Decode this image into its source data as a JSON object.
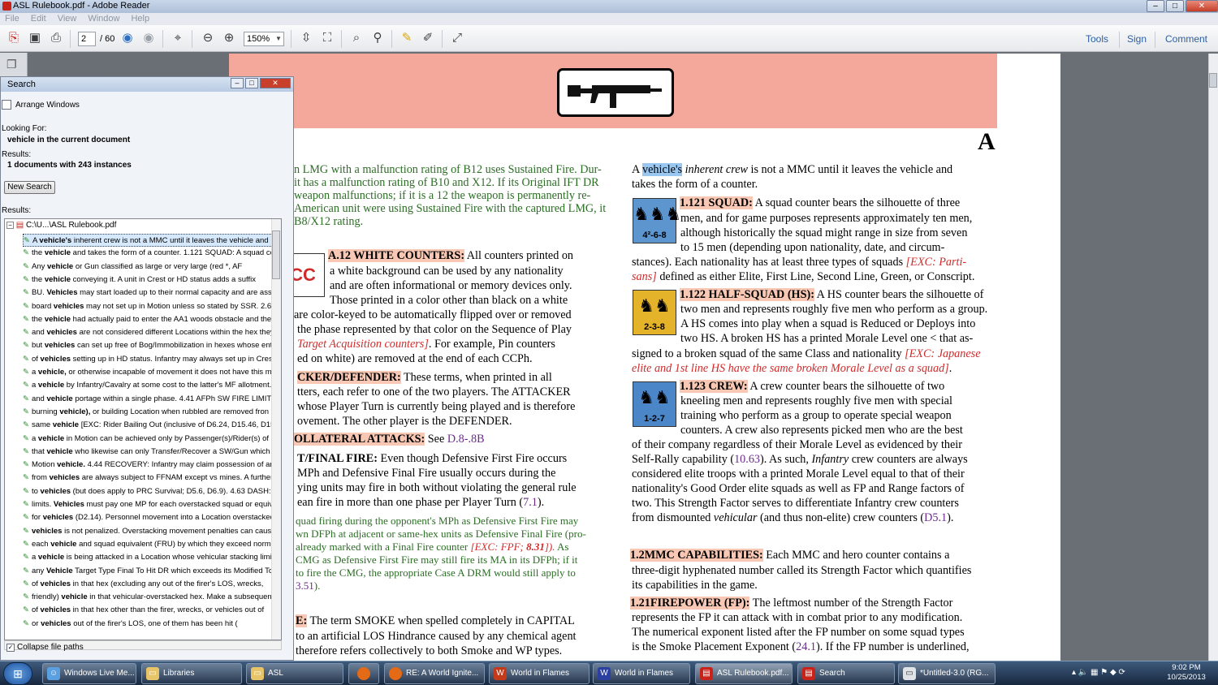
{
  "window": {
    "title": "ASL Rulebook.pdf - Adobe Reader",
    "minimize": "–",
    "maximize": "□",
    "close": "✕"
  },
  "menu": [
    "File",
    "Edit",
    "View",
    "Window",
    "Help"
  ],
  "toolbar": {
    "page_current": "2",
    "page_total": "/ 60",
    "zoom": "150%",
    "tools": "Tools",
    "sign": "Sign",
    "comment": "Comment"
  },
  "search": {
    "title": "Search",
    "arrange_windows": "Arrange Windows",
    "looking_for_label": "Looking For:",
    "looking_for_value": "vehicle in the current document",
    "results_label": "Results:",
    "results_value": "1 documents with 243 instances",
    "new_search": "New Search",
    "results_label2": "Results:",
    "tree_root": "C:\\U...\\ASL Rulebook.pdf",
    "collapse_label": "Collapse file paths",
    "results": [
      {
        "pre": "A ",
        "kw": "vehicle's",
        "post": " inherent crew is not a MMC until it leaves the vehicle and"
      },
      {
        "pre": "the ",
        "kw": "vehicle",
        "post": " and takes the form of a counter. 1.121 SQUAD: A squad co"
      },
      {
        "pre": "Any ",
        "kw": "vehicle",
        "post": " or Gun classified as large or very large (red *, AF"
      },
      {
        "pre": "the ",
        "kw": "vehicle",
        "post": " conveying it. A unit in Crest or HD status adds a suffix"
      },
      {
        "pre": "BU. ",
        "kw": "Vehicles",
        "post": " may start loaded up to their normal capacity and are assu"
      },
      {
        "pre": "board ",
        "kw": "vehicles",
        "post": " may not set up in Motion unless so stated by SSR. 2.6"
      },
      {
        "pre": "the ",
        "kw": "vehicle",
        "post": " had actually paid to enter the AA1 woods obstacle and the"
      },
      {
        "pre": "and ",
        "kw": "vehicles",
        "post": " are not considered different Locations within the hex they"
      },
      {
        "pre": "but ",
        "kw": "vehicles",
        "post": " can set up free of Bog/Immobilization in hexes whose ent"
      },
      {
        "pre": "of ",
        "kw": "vehicles",
        "post": " setting up in HD status. Infantry may always set up in Crest"
      },
      {
        "pre": "a ",
        "kw": "vehicle,",
        "post": " or otherwise incapable of movement it does not have this m"
      },
      {
        "pre": "a ",
        "kw": "vehicle",
        "post": " by Infantry/Cavalry at some cost to the latter's MF allotment."
      },
      {
        "pre": "and ",
        "kw": "vehicle",
        "post": " portage within a single phase. 4.41 AFPh SW FIRE LIMITS: I"
      },
      {
        "pre": "burning ",
        "kw": "vehicle),",
        "post": " or building Location when rubbled are removed fron"
      },
      {
        "pre": "same ",
        "kw": "vehicle",
        "post": " [EXC: Rider Bailing Out (inclusive of D6.24, D15.46, D15.5"
      },
      {
        "pre": "a ",
        "kw": "vehicle",
        "post": " in Motion can be achieved only by Passenger(s)/Rider(s) of"
      },
      {
        "pre": "that ",
        "kw": "vehicle",
        "post": " who likewise can only Transfer/Recover a SW/Gun which i"
      },
      {
        "pre": "Motion ",
        "kw": "vehicle.",
        "post": " 4.44 RECOVERY: Infantry may claim possession of an u"
      },
      {
        "pre": "from ",
        "kw": "vehicles",
        "post": " are always subject to FFNAM except vs mines. A further"
      },
      {
        "pre": "to ",
        "kw": "vehicles",
        "post": " (but does apply to PRC Survival; D5.6, D6.9). 4.63 DASH: Inf"
      },
      {
        "pre": "limits. ",
        "kw": "Vehicles",
        "post": " must pay one MP for each overstacked squad or equiv"
      },
      {
        "pre": "for ",
        "kw": "vehicles",
        "post": " (D2.14). Personnel movement into a Location overstacked"
      },
      {
        "pre": "",
        "kw": "vehicles",
        "post": " is not penalized. Overstacking movement penalties can cause"
      },
      {
        "pre": "each ",
        "kw": "vehicle",
        "post": " and squad equivalent (FRU) by which they exceed norma"
      },
      {
        "pre": "a ",
        "kw": "vehicle",
        "post": " is being attacked in a Location whose vehicular stacking limi"
      },
      {
        "pre": "any ",
        "kw": "Vehicle",
        "post": " Target Type Final To Hit DR which exceeds its Modified To"
      },
      {
        "pre": "of ",
        "kw": "vehicles",
        "post": " in that hex (excluding any out of the firer's LOS, wrecks,"
      },
      {
        "pre": "friendly) ",
        "kw": "vehicle",
        "post": " in that vehicular-overstacked hex. Make a subsequent"
      },
      {
        "pre": "of ",
        "kw": "vehicles",
        "post": " in that hex other than the firer, wrecks, or vehicles out of"
      },
      {
        "pre": "or ",
        "kw": "vehicles",
        "post": " out of the firer's LOS, one of them has been hit ("
      }
    ]
  },
  "doc": {
    "letter": "A",
    "left": {
      "l1": "n LMG with a malfunction rating of B12 uses Sustained Fire. Dur-",
      "l2": "it has a malfunction rating of B10 and X12. If its Original IFT DR",
      "l3": "weapon malfunctions; if it is a 12 the weapon is permanently re-",
      "l4": "American unit were using Sustained Fire with the captured LMG, it",
      "l5": "B8/X12 rating.",
      "cc": "CC",
      "wc_head": "A.12 WHITE COUNTERS:",
      "wc1": " All counters printed on",
      "wc2": "a white background can be used by any nationality",
      "wc3": "and are often informational or memory devices only.",
      "wc4": "Those printed in a color other than black on a white",
      "wc5": "are color-keyed to be automatically flipped over or removed",
      "wc6": "the phase represented by that color on the Sequence of Play",
      "wc7a": "Target Acquisition counters]",
      "wc7b": ".  For example, Pin counters",
      "wc8": "ed on white) are removed at the end of each CCPh.",
      "ad_head": "CKER/DEFENDER:",
      "ad1": " These terms, when printed in all",
      "ad2": "tters, each refer to one of the two players. The ATTACKER",
      "ad3": "whose Player Turn is currently being played and is therefore",
      "ad4": "ovement. The other player is the DEFENDER.",
      "co_head": "OLLATERAL ATTACKS:",
      "co_see": " See ",
      "co_ref": "D.8-.8B",
      "ff_head": "T/FINAL FIRE:",
      "ff1": " Even though Defensive First Fire occurs",
      "ff2": "MPh and Defensive Final Fire usually occurs during the",
      "ff3": "ying units may fire in both without violating the general rule",
      "ff4a": "ean fire in more than one phase per Player Turn (",
      "ff4b": "7.1",
      "ff4c": ").",
      "g1": "quad firing during the opponent's MPh as Defensive First Fire may",
      "g2": "wn DFPh at adjacent or same-hex units as Defensive Final Fire (pro-",
      "g3a": "already marked with a Final Fire counter ",
      "g3b": "[EXC: FPF; ",
      "g3c": "8.31",
      "g3d": "]).",
      "g3e": " As",
      "g4": "CMG as Defensive First Fire may still fire its MA in its DFPh; if it",
      "g5": "to fire the CMG, the appropriate Case A DRM would still apply to",
      "g6": "3.51",
      "g6b": ").",
      "sm_head": "E:",
      "sm1": " The term SMOKE when spelled completely in CAPITAL",
      "sm2": "to an artificial LOS Hindrance caused by any chemical agent",
      "sm3": "therefore refers collectively to both Smoke and WP types."
    },
    "right": {
      "r1a": "A ",
      "r1sel": "vehicle's",
      "r1b": " inherent crew",
      "r1c": " is not a MMC until it leaves the vehicle and",
      "r2": "takes the form of a counter.",
      "sq_head": "1.121 SQUAD:",
      "sq1": " A squad counter bears the silhouette of three",
      "sq2": "men, and for game purposes represents approximately ten men,",
      "sq3": "although historically the squad might range in size from seven",
      "sq4": "to 15 men (depending upon nationality, date, and circum-",
      "sq5a": "stances). Each nationality has at least three types of squads ",
      "sq5b": "[EXC: Parti-",
      "sq6a": "sans]",
      "sq6b": " defined as either Elite, First Line, Second Line, Green, or Conscript.",
      "hs_head": "1.122 HALF-SQUAD (HS):",
      "hs1": " A HS counter bears the silhouette of",
      "hs2": "two men and represents roughly five men who perform as a group.",
      "hs3": "A HS comes into play when a squad is Reduced or Deploys into",
      "hs4": "two HS. A broken HS has a printed Morale Level one < that as-",
      "hs5a": "signed to a broken squad of the same Class and nationality ",
      "hs5b": "[EXC: Japanese",
      "hs6a": "elite and 1st line HS have the same broken Morale Level as a squad]",
      "hs6b": ".",
      "cr_head": "1.123 CREW:",
      "cr1": "  A crew counter bears the silhouette of two",
      "cr2": "kneeling men and represents roughly five men with special",
      "cr3": "training who perform as a group to operate special weapon",
      "cr4": "counters. A crew also represents picked men who are the best",
      "cr5": "of their company regardless of their Morale Level as evidenced by their",
      "cr6a": "Self-Rally capability (",
      "cr6b": "10.63",
      "cr6c": "). As such, ",
      "cr6d": "Infantry",
      "cr6e": " crew counters are always",
      "cr7": "considered elite troops with a printed Morale Level equal to that of their",
      "cr8": "nationality's Good Order elite squads as well as FP and Range factors of",
      "cr9": "two. This Strength Factor serves to differentiate Infantry crew counters",
      "cr10a": "from dismounted ",
      "cr10b": "vehicular",
      "cr10c": " (and thus non-elite) crew counters (",
      "cr10d": "D5.1",
      "cr10e": ").",
      "mc_head": "1.2",
      "mc_head2": "MMC CAPABILITIES:",
      "mc1": " Each MMC and hero counter contains a",
      "mc2": "three-digit hyphenated number called its Strength Factor which quantifies",
      "mc3": "its capabilities in the game.",
      "fp_head": "1.21",
      "fp_head2": "FIREPOWER (FP):",
      "fp1": " The leftmost number of the Strength Factor",
      "fp2": "represents the FP it can attack with in combat prior to any modification.",
      "fp3": "The numerical exponent listed after the FP number on some squad types",
      "fp4a": "is the Smoke Placement Exponent (",
      "fp4b": "24.1",
      "fp4c": "). If the FP number is underlined,"
    },
    "counters": {
      "squad": "4²-6-8",
      "hs": "2-3-8",
      "crew": "1-2-7",
      "squad_colors": "#4e86c4",
      "hs_color": "#e5b32a"
    }
  },
  "taskbar": {
    "items": [
      "Windows Live Me...",
      "Libraries",
      "ASL",
      "",
      "RE: A World Ignite...",
      "World in Flames",
      "World in Flames",
      "ASL Rulebook.pdf...",
      "Search",
      "*Untitled-3.0 (RG..."
    ],
    "clock_time": "9:02 PM",
    "clock_date": "10/25/2013"
  }
}
